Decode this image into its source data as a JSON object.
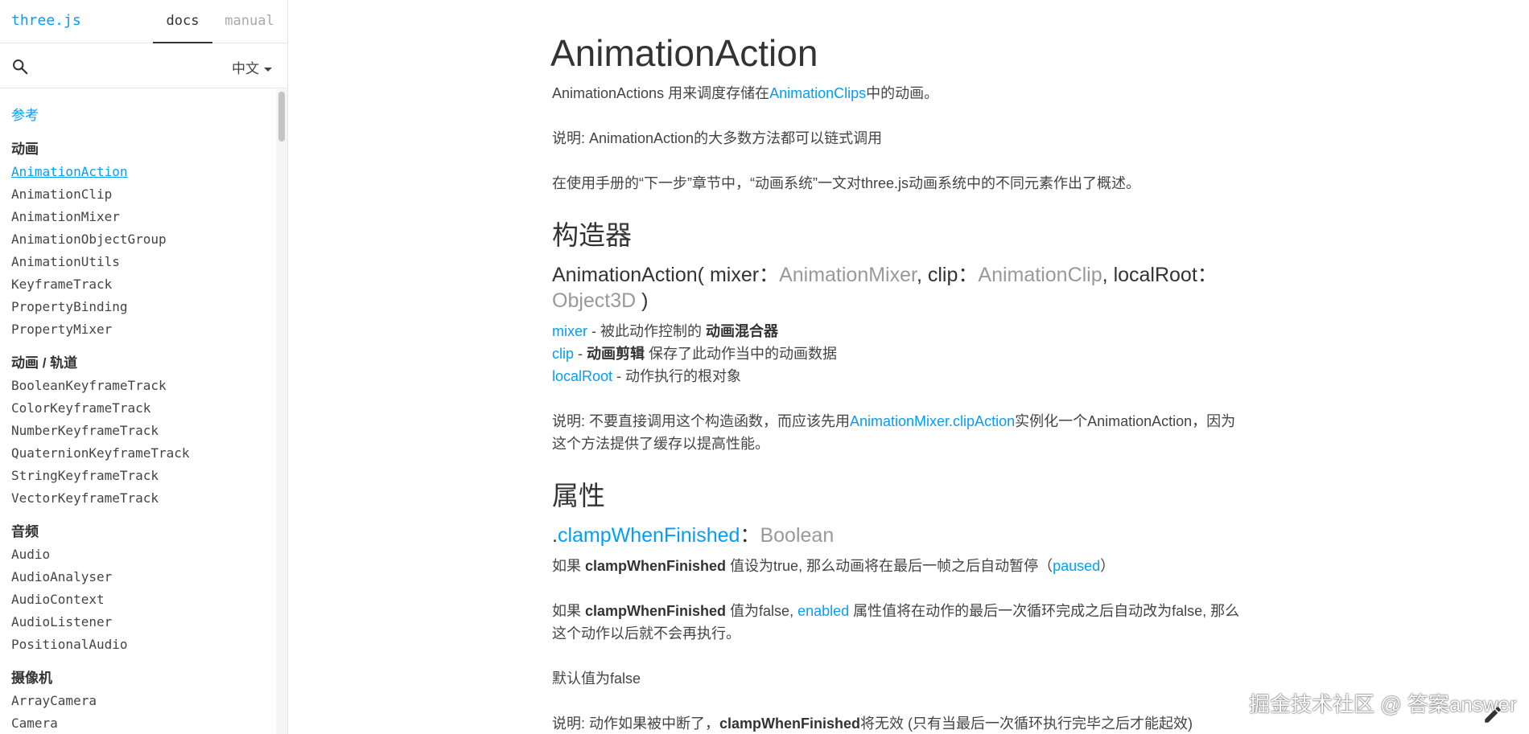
{
  "header": {
    "brand": "three.js",
    "tabs": [
      {
        "label": "docs",
        "active": true
      },
      {
        "label": "manual",
        "active": false
      }
    ]
  },
  "filter": {
    "placeholder": "",
    "value": "",
    "language": "中文"
  },
  "nav": {
    "root": "参考",
    "sections": [
      {
        "heading": "动画",
        "items": [
          "AnimationAction",
          "AnimationClip",
          "AnimationMixer",
          "AnimationObjectGroup",
          "AnimationUtils",
          "KeyframeTrack",
          "PropertyBinding",
          "PropertyMixer"
        ]
      },
      {
        "heading": "动画 / 轨道",
        "items": [
          "BooleanKeyframeTrack",
          "ColorKeyframeTrack",
          "NumberKeyframeTrack",
          "QuaternionKeyframeTrack",
          "StringKeyframeTrack",
          "VectorKeyframeTrack"
        ]
      },
      {
        "heading": "音频",
        "items": [
          "Audio",
          "AudioAnalyser",
          "AudioContext",
          "AudioListener",
          "PositionalAudio"
        ]
      },
      {
        "heading": "摄像机",
        "items": [
          "ArrayCamera",
          "Camera"
        ]
      }
    ],
    "selected": "AnimationAction"
  },
  "doc": {
    "title": "AnimationAction",
    "intro": {
      "before": "AnimationActions 用来调度存储在",
      "link": "AnimationClips",
      "after": "中的动画。"
    },
    "note1": "说明: AnimationAction的大多数方法都可以链式调用",
    "note2": "在使用手册的“下一步”章节中，“动画系统”一文对three.js动画系统中的不同元素作出了概述。",
    "constructor_heading": "构造器",
    "signature": {
      "name": "AnimationAction(",
      "p1": "mixer",
      "t1": "AnimationMixer",
      "p2": "clip",
      "t2": "AnimationClip",
      "p3": "localRoot",
      "t3": "Object3D",
      "close": ")",
      "colon": "：",
      "comma": ","
    },
    "params": [
      {
        "name": "mixer",
        "pre": " - 被此动作控制的 ",
        "bold": "动画混合器",
        "post": ""
      },
      {
        "name": "clip",
        "pre": " - ",
        "bold": "动画剪辑",
        "post": " 保存了此动作当中的动画数据"
      },
      {
        "name": "localRoot",
        "pre": " - 动作执行的根对象",
        "bold": "",
        "post": ""
      }
    ],
    "constructor_note": {
      "before": "说明: 不要直接调用这个构造函数，而应该先用",
      "link": "AnimationMixer.clipAction",
      "after": "实例化一个AnimationAction，因为这个方法提供了缓存以提高性能。"
    },
    "properties_heading": "属性",
    "property": {
      "dot": ".",
      "name": "clampWhenFinished",
      "colon": "：",
      "type": "Boolean"
    },
    "prop_p1": {
      "a": "如果 ",
      "b": "clampWhenFinished",
      "c": " 值设为true, 那么动画将在最后一帧之后自动暂停（",
      "link": "paused",
      "d": "）"
    },
    "prop_p2": {
      "a": "如果 ",
      "b": "clampWhenFinished",
      "c": " 值为false, ",
      "link": "enabled",
      "d": " 属性值将在动作的最后一次循环完成之后自动改为false, 那么这个动作以后就不会再执行。"
    },
    "prop_default": "默认值为false",
    "prop_p3": {
      "a": "说明: 动作如果被中断了，",
      "b": "clampWhenFinished",
      "c": "将无效 (只有当最后一次循环执行完毕之后才能起效)"
    }
  },
  "watermark": "掘金技术社区 @ 答案answer",
  "colors": {
    "accent": "#049EF4",
    "text": "#444444",
    "type": "#999999"
  },
  "icons": {
    "search": "search-icon",
    "edit": "pencil-icon",
    "dropdown": "caret-down-icon"
  }
}
